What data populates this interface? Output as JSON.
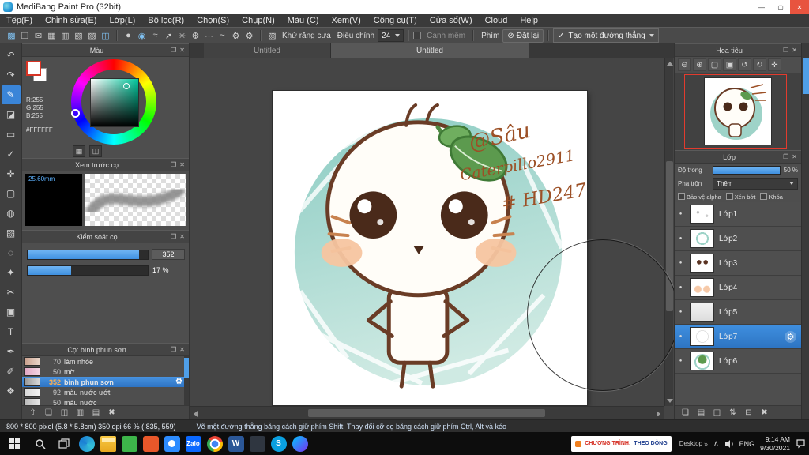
{
  "window": {
    "title": "MediBang Paint Pro (32bit)",
    "controls": {
      "minimize": "—",
      "maximize": "▢",
      "close": "✕"
    }
  },
  "menu": {
    "items": [
      "Tệp(F)",
      "Chỉnh sửa(E)",
      "Lớp(L)",
      "Bộ lọc(R)",
      "Chọn(S)",
      "Chụp(N)",
      "Màu (C)",
      "Xem(V)",
      "Công cụ(T)",
      "Cửa sổ(W)",
      "Cloud",
      "Help"
    ]
  },
  "toolbar": {
    "file_icons": [
      "▩",
      "❏",
      "✉",
      "▦",
      "▥",
      "▧",
      "▨",
      "◫"
    ],
    "brush_icons": [
      "●",
      "◉",
      "≈",
      "➚",
      "✳",
      "❆",
      "⋯",
      "~",
      "⚙",
      "⚙"
    ],
    "antialias_icon": "▧",
    "antialias_label": "Khử răng cưa",
    "adjust_label": "Điều chỉnh",
    "adjust_value": "24",
    "soft_label": "Canh mềm",
    "key_label": "Phím",
    "reset_icon": "⊘",
    "reset_label": "Đặt lại",
    "line_check": "✓",
    "line_label": "Tạo một đường thẳng"
  },
  "tool_strip": {
    "glyphs": [
      "↶",
      "↷",
      "✎",
      "◪",
      "▭",
      "✓",
      "✛",
      "▢",
      "◍",
      "▨",
      "◌",
      "✦",
      "✂",
      "▣",
      "T",
      "✒",
      "✐",
      "❖"
    ]
  },
  "tabs": {
    "items": [
      "Untitled",
      "Untitled"
    ]
  },
  "panel_icons": {
    "popout": "❐",
    "close": "✕"
  },
  "icons": {
    "gear": "⚙",
    "bullet": "●"
  },
  "color_panel": {
    "title": "Màu",
    "r": "R:255",
    "g": "G:255",
    "b": "B:255",
    "hex": "#FFFFFF"
  },
  "brush_preview": {
    "title": "Xem trước cọ",
    "size": "25.60mm"
  },
  "brush_control": {
    "title": "Kiểm soát cọ",
    "size_value": "352",
    "opacity_value": "17 %"
  },
  "brush_list": {
    "title": "Cọ: bình phun sơn",
    "items": [
      {
        "num": "70",
        "name": "làm nhòe"
      },
      {
        "num": "50",
        "name": "mờ"
      },
      {
        "num": "352",
        "name": "bình phun sơn"
      },
      {
        "num": "92",
        "name": "màu nước ướt"
      },
      {
        "num": "50",
        "name": "màu nước"
      }
    ],
    "bottom_icons": [
      "⇧",
      "❏",
      "◫",
      "▥",
      "▤",
      "✖"
    ]
  },
  "navigator": {
    "title": "Hoa tiêu",
    "zoom_icons": [
      "⊖",
      "⊕",
      "▢",
      "▣",
      "↺",
      "↻",
      "✛"
    ]
  },
  "layers": {
    "title": "Lớp",
    "opacity_label": "Độ trong",
    "opacity_value": "50 %",
    "blend_label": "Pha trộn",
    "blend_value": "Thêm",
    "alpha_label": "Bảo vệ alpha",
    "clip_label": "Xén bớt",
    "lock_label": "Khóa",
    "items": [
      {
        "name": "Lớp1"
      },
      {
        "name": "Lớp2"
      },
      {
        "name": "Lớp3"
      },
      {
        "name": "Lớp4"
      },
      {
        "name": "Lớp5"
      },
      {
        "name": "Lớp7"
      },
      {
        "name": "Lớp6"
      }
    ],
    "bottom_icons": [
      "❏",
      "▤",
      "◫",
      "⇅",
      "⊟",
      "✖"
    ]
  },
  "canvas": {
    "signature_line1": "@Sâu",
    "signature_line2": "Caterpillo2911",
    "signature_line3": "# HD247"
  },
  "status": {
    "info": "800 * 800 pixel   (5.8 * 5.8cm)   350 dpi   66 %   ( 835, 559)",
    "hint": "Vẽ một đường thẳng bằng cách giữ phím Shift, Thay đổi cỡ cọ bằng cách giữ phím Ctrl, Alt và kéo"
  },
  "taskbar": {
    "toast_label": "CHƯƠNG TRÌNH:",
    "toast_value": "THEO DÒNG",
    "app_letters": {
      "zalo": "Zalo",
      "word": "W",
      "skype": "S"
    },
    "desktop_label": "Desktop",
    "desktop_chevron": "»",
    "tray_caret": "∧",
    "lang": "ENG",
    "time": "9:14 AM",
    "date": "9/30/2021"
  }
}
